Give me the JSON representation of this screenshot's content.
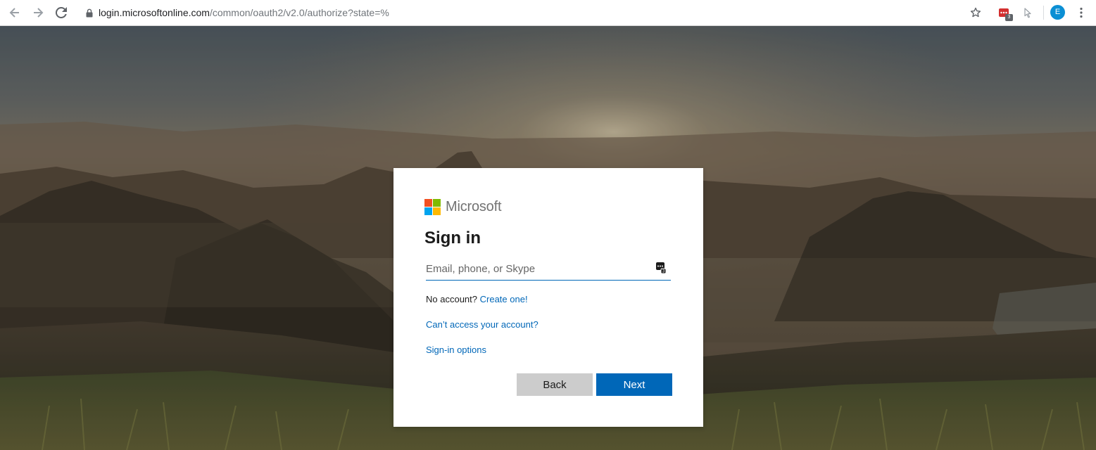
{
  "browser": {
    "url_host": "login.microsoftonline.com",
    "url_path": "/common/oauth2/v2.0/authorize?state=%",
    "extension_badge": "3",
    "profile_initial": "E"
  },
  "signin": {
    "brand_name": "Microsoft",
    "title": "Sign in",
    "email_placeholder": "Email, phone, or Skype",
    "no_account_text": "No account?",
    "create_link": "Create one!",
    "cant_access_link": "Can’t access your account?",
    "options_link": "Sign-in options",
    "back_label": "Back",
    "next_label": "Next"
  },
  "icons": {
    "back": "arrow-left-icon",
    "forward": "arrow-right-icon",
    "reload": "reload-icon",
    "lock": "lock-icon",
    "bookmark": "star-icon",
    "extension": "password-manager-extension-icon",
    "cast": "cursor-extension-icon",
    "menu": "kebab-menu-icon",
    "field_autofill": "password-manager-autofill-icon"
  },
  "colors": {
    "ms_red": "#f25022",
    "ms_green": "#7fba00",
    "ms_blue": "#00a4ef",
    "ms_yellow": "#ffb900",
    "accent_blue": "#0067b8",
    "back_button": "#cccccc"
  }
}
